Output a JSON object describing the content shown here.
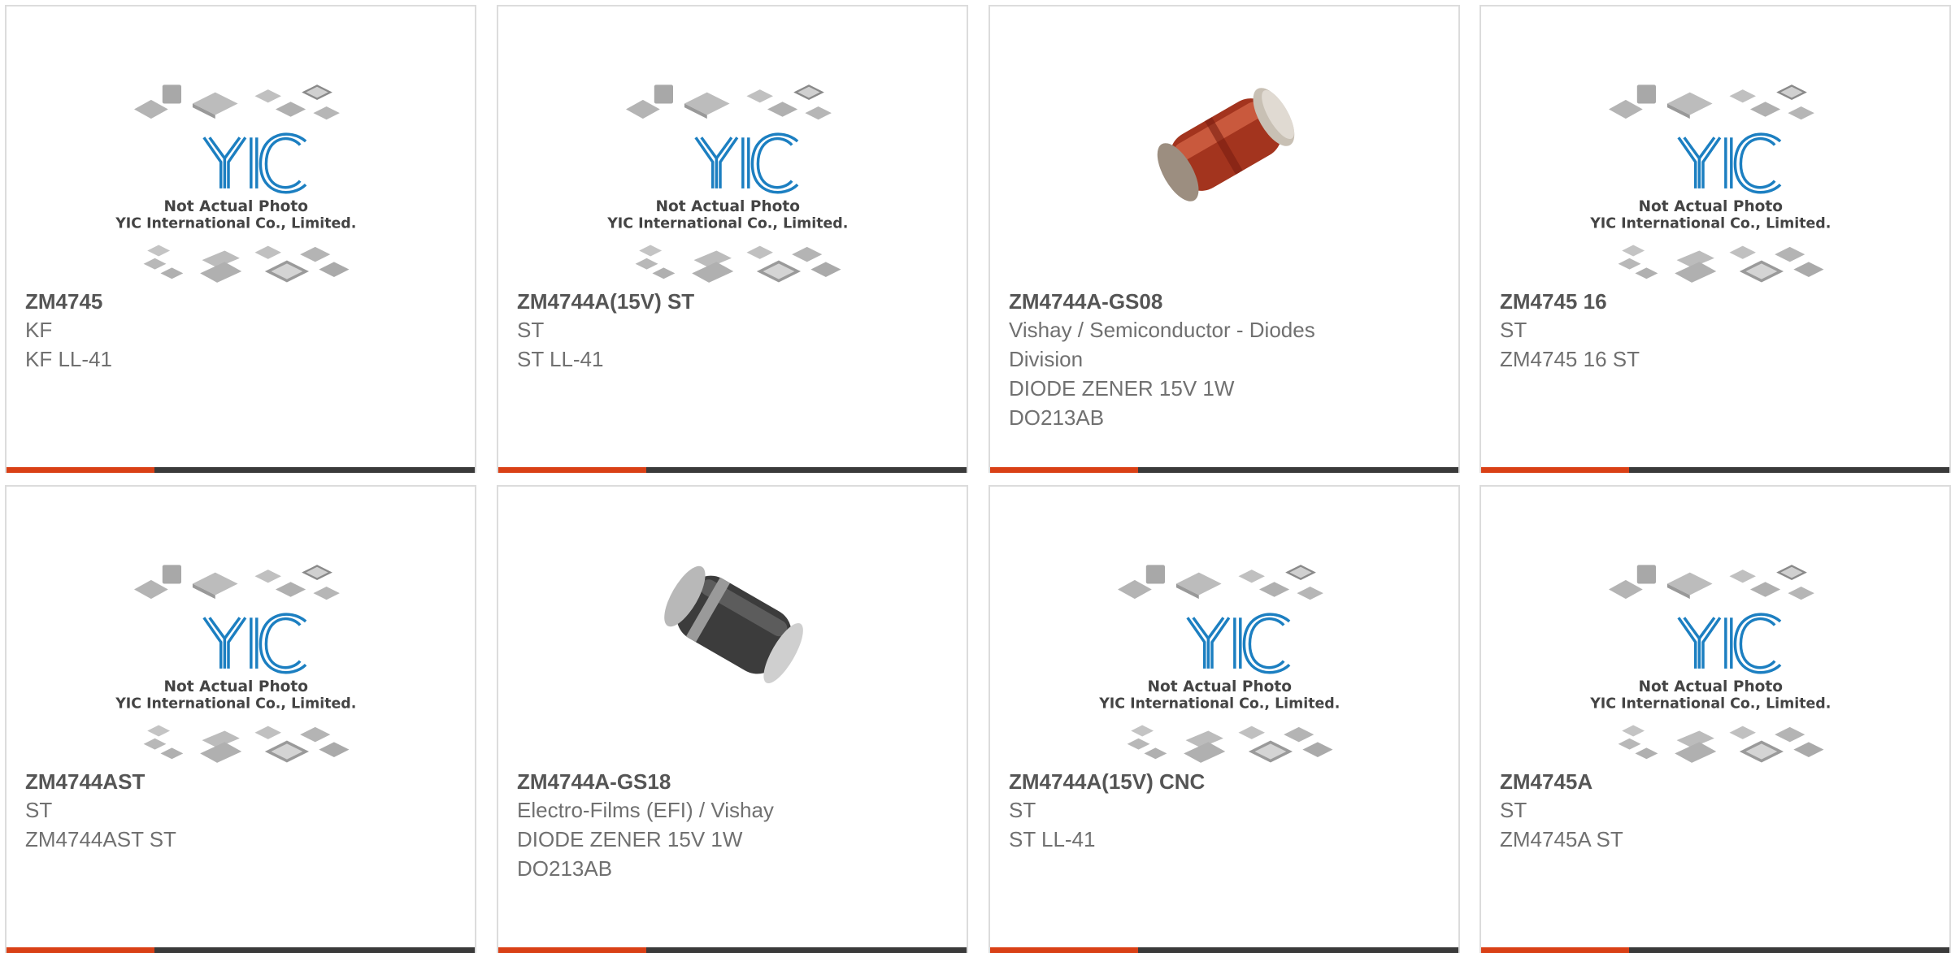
{
  "placeholder": {
    "brand": "YIC",
    "line1": "Not Actual Photo",
    "line2": "YIC International Co., Limited."
  },
  "colors": {
    "accent": "#d94016",
    "bar": "#3a3a3a",
    "brand_blue": "#1c7fc1"
  },
  "products": [
    {
      "part": "ZM4745",
      "lines": [
        "KF",
        "KF LL-41"
      ],
      "image": "placeholder"
    },
    {
      "part": "ZM4744A(15V) ST",
      "lines": [
        "ST",
        "ST LL-41"
      ],
      "image": "placeholder"
    },
    {
      "part": "ZM4744A-GS08",
      "lines": [
        "Vishay / Semiconductor - Diodes",
        "Division",
        "DIODE ZENER 15V 1W",
        "DO213AB"
      ],
      "image": "red-melf-diode"
    },
    {
      "part": "ZM4745 16",
      "lines": [
        "ST",
        "ZM4745 16 ST"
      ],
      "image": "placeholder"
    },
    {
      "part": "ZM4744AST",
      "lines": [
        "ST",
        "ZM4744AST ST"
      ],
      "image": "placeholder"
    },
    {
      "part": "ZM4744A-GS18",
      "lines": [
        "Electro-Films (EFI) / Vishay",
        "DIODE ZENER 15V 1W",
        "DO213AB"
      ],
      "image": "black-melf-diode"
    },
    {
      "part": "ZM4744A(15V) CNC",
      "lines": [
        "ST",
        "ST LL-41"
      ],
      "image": "placeholder"
    },
    {
      "part": "ZM4745A",
      "lines": [
        "ST",
        "ZM4745A ST"
      ],
      "image": "placeholder"
    }
  ]
}
